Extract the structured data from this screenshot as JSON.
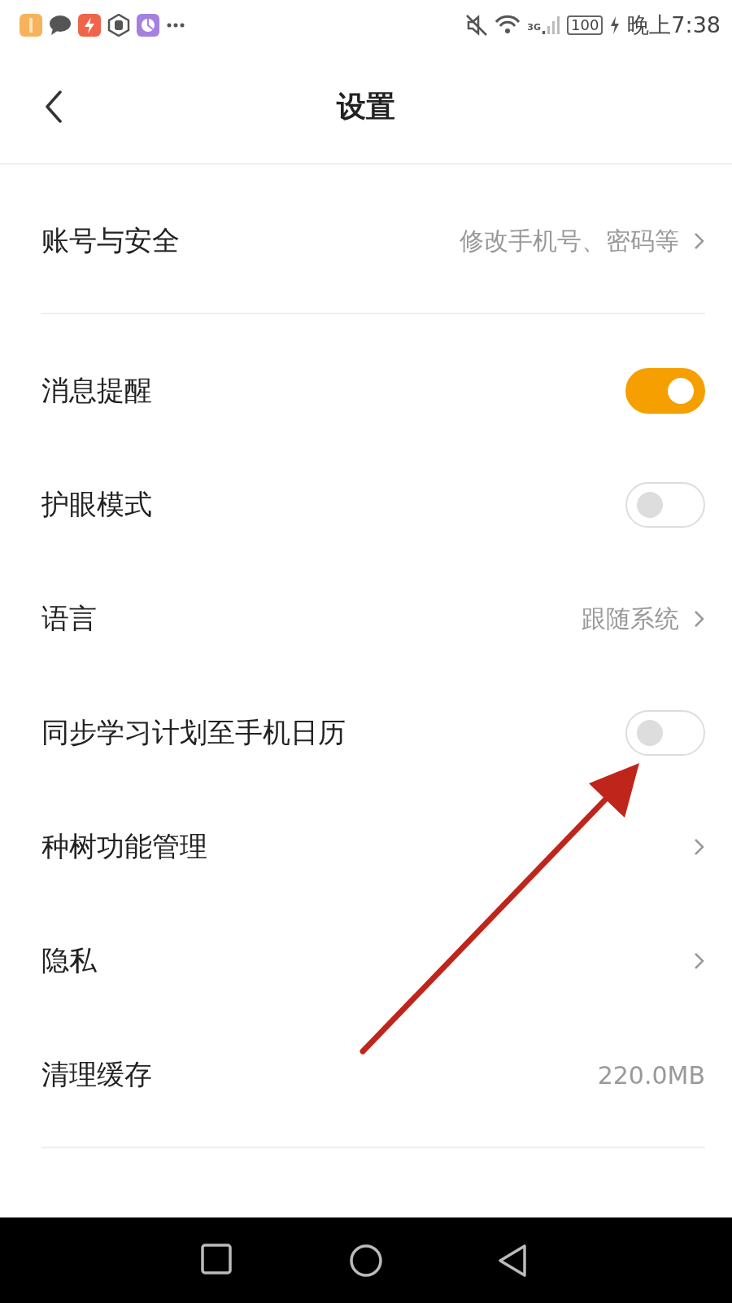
{
  "status_bar": {
    "network": "3G",
    "battery": "100",
    "time": "晚上7:38"
  },
  "header": {
    "title": "设置"
  },
  "sections": [
    {
      "rows": [
        {
          "kind": "link",
          "label": "账号与安全",
          "value": "修改手机号、密码等"
        }
      ]
    },
    {
      "rows": [
        {
          "kind": "toggle",
          "label": "消息提醒",
          "on": true
        },
        {
          "kind": "toggle",
          "label": "护眼模式",
          "on": false
        },
        {
          "kind": "link",
          "label": "语言",
          "value": "跟随系统"
        },
        {
          "kind": "toggle",
          "label": "同步学习计划至手机日历",
          "on": false
        },
        {
          "kind": "link",
          "label": "种树功能管理"
        },
        {
          "kind": "link",
          "label": "隐私"
        },
        {
          "kind": "info",
          "label": "清理缓存",
          "value": "220.0MB"
        }
      ]
    }
  ]
}
